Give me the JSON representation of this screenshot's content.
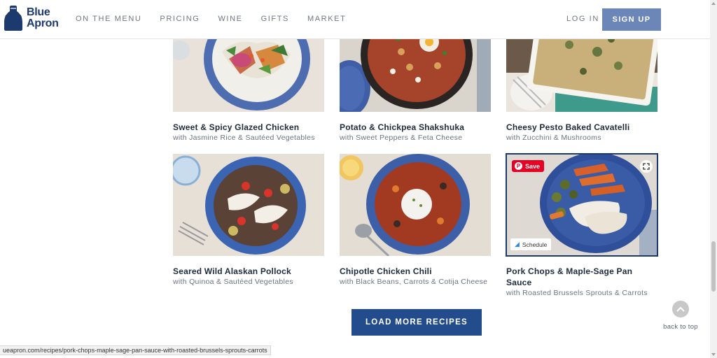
{
  "brand": {
    "name_line1": "Blue",
    "name_line2": "Apron",
    "icon": "apron-logo-icon",
    "color": "#1d3a6e"
  },
  "nav": {
    "items": [
      {
        "label": "ON THE MENU"
      },
      {
        "label": "PRICING"
      },
      {
        "label": "WINE"
      },
      {
        "label": "GIFTS"
      },
      {
        "label": "MARKET"
      }
    ]
  },
  "header": {
    "login_label": "LOG IN",
    "signup_label": "SIGN UP",
    "signup_color": "#6c86b7"
  },
  "recipes": [
    {
      "title": "Sweet & Spicy Glazed Chicken",
      "subtitle": "with Jasmine Rice & Sautéed Vegetables"
    },
    {
      "title": "Potato & Chickpea Shakshuka",
      "subtitle": "with Sweet Peppers & Feta Cheese"
    },
    {
      "title": "Cheesy Pesto Baked Cavatelli",
      "subtitle": "with Zucchini & Mushrooms"
    },
    {
      "title": "Seared Wild Alaskan Pollock",
      "subtitle": "with Quinoa & Sautéed Vegetables"
    },
    {
      "title": "Chipotle Chicken Chili",
      "subtitle": "with Black Beans, Carrots & Cotija Cheese"
    },
    {
      "title": "Pork Chops & Maple-Sage Pan Sauce",
      "subtitle": "with Roasted Brussels Sprouts & Carrots"
    }
  ],
  "overlay": {
    "save_label": "Save",
    "schedule_label": "Schedule"
  },
  "load_more_label": "LOAD MORE RECIPES",
  "load_more_color": "#234c8d",
  "back_to_top_label": "back to top",
  "status_url": "ueapron.com/recipes/pork-chops-maple-sage-pan-sauce-with-roasted-brussels-sprouts-carrots"
}
